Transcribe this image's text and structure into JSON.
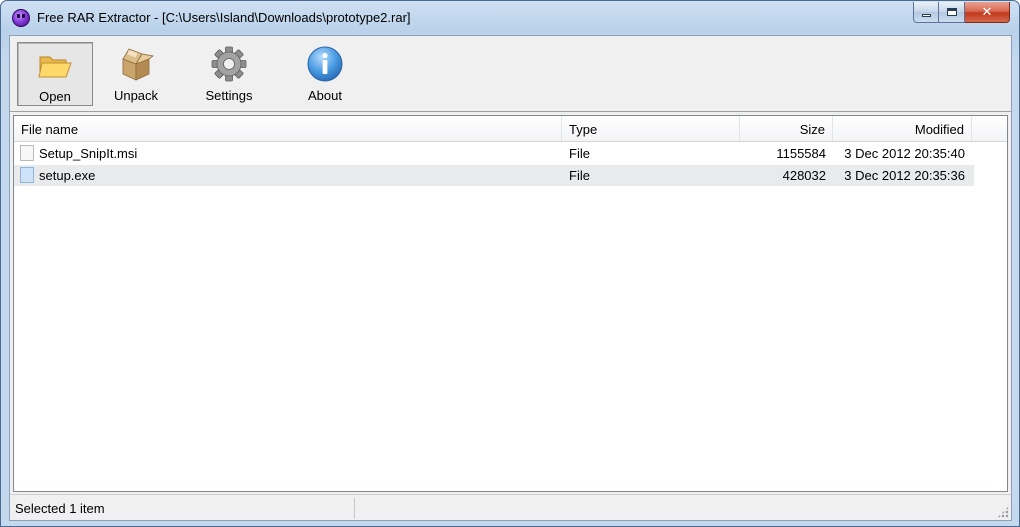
{
  "window": {
    "title": "Free RAR Extractor - [C:\\Users\\Island\\Downloads\\prototype2.rar]",
    "controls": {
      "minimize": "",
      "maximize": "",
      "close": "✕"
    }
  },
  "toolbar": {
    "open_label": "Open",
    "unpack_label": "Unpack",
    "settings_label": "Settings",
    "about_label": "About"
  },
  "list": {
    "columns": {
      "name": "File name",
      "type": "Type",
      "size": "Size",
      "modified": "Modified"
    },
    "rows": [
      {
        "name": "Setup_SnipIt.msi",
        "type": "File",
        "size": "1155584",
        "modified": "3 Dec 2012 20:35:40",
        "icon": "msi-file-icon"
      },
      {
        "name": "setup.exe",
        "type": "File",
        "size": "428032",
        "modified": "3 Dec 2012 20:35:36",
        "icon": "exe-file-icon"
      }
    ]
  },
  "status": {
    "text": "Selected 1 item"
  },
  "colors": {
    "selection": "#e8eaec",
    "close_button": "#c0391b",
    "about_icon": "#3a8fd6"
  }
}
